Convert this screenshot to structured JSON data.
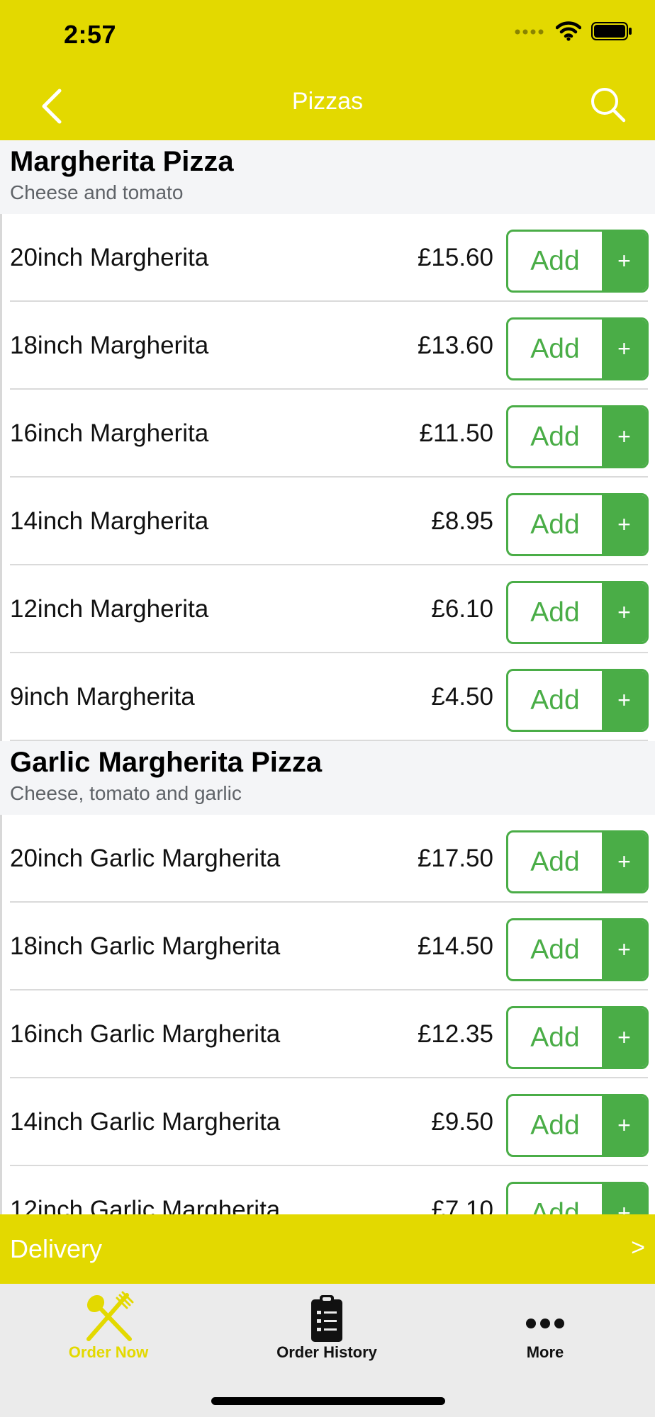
{
  "status_bar": {
    "time": "2:57"
  },
  "nav": {
    "title": "Pizzas"
  },
  "sections": [
    {
      "title": "Margherita Pizza",
      "subtitle": "Cheese and tomato",
      "items": [
        {
          "name": "20inch Margherita",
          "price": "£15.60"
        },
        {
          "name": "18inch Margherita",
          "price": "£13.60"
        },
        {
          "name": "16inch Margherita",
          "price": "£11.50"
        },
        {
          "name": "14inch Margherita",
          "price": "£8.95"
        },
        {
          "name": "12inch Margherita",
          "price": "£6.10"
        },
        {
          "name": "9inch Margherita",
          "price": "£4.50"
        }
      ]
    },
    {
      "title": "Garlic Margherita Pizza",
      "subtitle": "Cheese, tomato and garlic",
      "items": [
        {
          "name": "20inch Garlic Margherita",
          "price": "£17.50"
        },
        {
          "name": "18inch Garlic Margherita",
          "price": "£14.50"
        },
        {
          "name": "16inch Garlic Margherita",
          "price": "£12.35"
        },
        {
          "name": "14inch Garlic Margherita",
          "price": "£9.50"
        },
        {
          "name": "12inch Garlic Margherita",
          "price": "£7.10"
        }
      ]
    }
  ],
  "add_button": {
    "label": "Add",
    "plus": "+"
  },
  "delivery_bar": {
    "label": "Delivery",
    "arrow": ">"
  },
  "tabs": [
    {
      "label": "Order Now",
      "icon": "fork-spoon-icon",
      "active": true
    },
    {
      "label": "Order History",
      "icon": "clipboard-icon",
      "active": false
    },
    {
      "label": "More",
      "icon": "more-dots-icon",
      "active": false
    }
  ],
  "colors": {
    "brand_yellow": "#e3d900",
    "add_green": "#4aad47",
    "section_bg": "#f4f5f7"
  }
}
